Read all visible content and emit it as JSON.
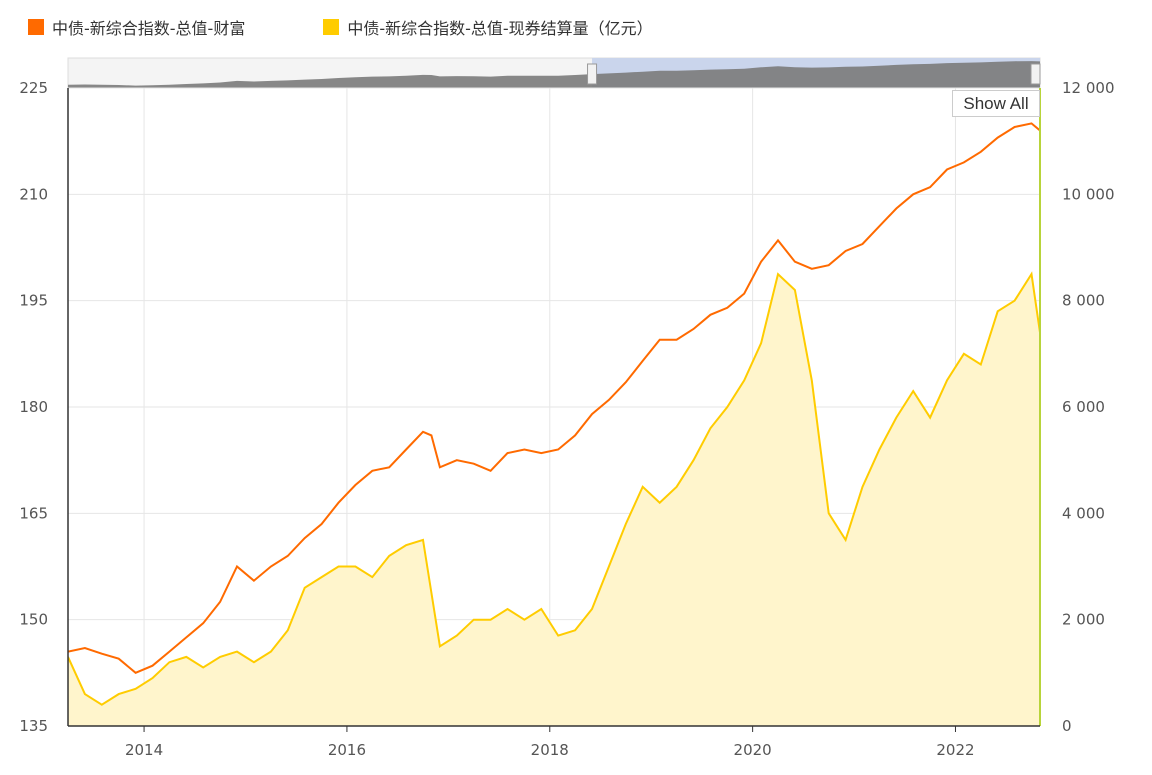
{
  "legend": {
    "items": [
      {
        "label": "中债-新综合指数-总值-财富",
        "color": "#ff6a00"
      },
      {
        "label": "中债-新综合指数-总值-现券结算量（亿元）",
        "color": "#ffcc00"
      }
    ]
  },
  "controls": {
    "show_all_label": "Show All"
  },
  "chart_data": {
    "type": "line",
    "x_range": [
      "2013-04",
      "2022-11"
    ],
    "x_ticks": [
      "2014",
      "2016",
      "2018",
      "2020",
      "2022"
    ],
    "y_left": {
      "range": [
        135,
        225
      ],
      "ticks": [
        "135",
        "150",
        "165",
        "180",
        "195",
        "210",
        "225"
      ]
    },
    "y_right": {
      "range": [
        0,
        12000
      ],
      "ticks": [
        "0",
        "2 000",
        "4 000",
        "6 000",
        "8 000",
        "10 000",
        "12 000"
      ]
    },
    "grid": true,
    "legend_position": "top-left",
    "navigator": {
      "selected_range": [
        "2018-06",
        "2022-11"
      ]
    },
    "series": [
      {
        "name": "中债-新综合指数-总值-财富",
        "axis": "left",
        "color": "#ff6a00",
        "kind": "line",
        "points": [
          [
            "2013-04",
            145.5
          ],
          [
            "2013-06",
            146.0
          ],
          [
            "2013-08",
            145.2
          ],
          [
            "2013-10",
            144.5
          ],
          [
            "2013-12",
            142.5
          ],
          [
            "2014-02",
            143.5
          ],
          [
            "2014-04",
            145.5
          ],
          [
            "2014-06",
            147.5
          ],
          [
            "2014-08",
            149.5
          ],
          [
            "2014-10",
            152.5
          ],
          [
            "2014-12",
            157.5
          ],
          [
            "2015-02",
            155.5
          ],
          [
            "2015-04",
            157.5
          ],
          [
            "2015-06",
            159.0
          ],
          [
            "2015-08",
            161.5
          ],
          [
            "2015-10",
            163.5
          ],
          [
            "2015-12",
            166.5
          ],
          [
            "2016-02",
            169.0
          ],
          [
            "2016-04",
            171.0
          ],
          [
            "2016-06",
            171.5
          ],
          [
            "2016-08",
            174.0
          ],
          [
            "2016-10",
            176.5
          ],
          [
            "2016-11",
            176.0
          ],
          [
            "2016-12",
            171.5
          ],
          [
            "2017-02",
            172.5
          ],
          [
            "2017-04",
            172.0
          ],
          [
            "2017-06",
            171.0
          ],
          [
            "2017-08",
            173.5
          ],
          [
            "2017-10",
            174.0
          ],
          [
            "2017-12",
            173.5
          ],
          [
            "2018-02",
            174.0
          ],
          [
            "2018-04",
            176.0
          ],
          [
            "2018-06",
            179.0
          ],
          [
            "2018-08",
            181.0
          ],
          [
            "2018-10",
            183.5
          ],
          [
            "2018-12",
            186.5
          ],
          [
            "2019-02",
            189.5
          ],
          [
            "2019-04",
            189.5
          ],
          [
            "2019-06",
            191.0
          ],
          [
            "2019-08",
            193.0
          ],
          [
            "2019-10",
            194.0
          ],
          [
            "2019-12",
            196.0
          ],
          [
            "2020-02",
            200.5
          ],
          [
            "2020-04",
            203.5
          ],
          [
            "2020-06",
            200.5
          ],
          [
            "2020-08",
            199.5
          ],
          [
            "2020-10",
            200.0
          ],
          [
            "2020-12",
            202.0
          ],
          [
            "2021-02",
            203.0
          ],
          [
            "2021-04",
            205.5
          ],
          [
            "2021-06",
            208.0
          ],
          [
            "2021-08",
            210.0
          ],
          [
            "2021-10",
            211.0
          ],
          [
            "2021-12",
            213.5
          ],
          [
            "2022-02",
            214.5
          ],
          [
            "2022-04",
            216.0
          ],
          [
            "2022-06",
            218.0
          ],
          [
            "2022-08",
            219.5
          ],
          [
            "2022-10",
            220.0
          ],
          [
            "2022-11",
            219.0
          ]
        ]
      },
      {
        "name": "中债-新综合指数-总值-现券结算量（亿元）",
        "axis": "right",
        "color": "#ffcc00",
        "kind": "area",
        "points": [
          [
            "2013-04",
            1300
          ],
          [
            "2013-06",
            600
          ],
          [
            "2013-08",
            400
          ],
          [
            "2013-10",
            600
          ],
          [
            "2013-12",
            700
          ],
          [
            "2014-02",
            900
          ],
          [
            "2014-04",
            1200
          ],
          [
            "2014-06",
            1300
          ],
          [
            "2014-08",
            1100
          ],
          [
            "2014-10",
            1300
          ],
          [
            "2014-12",
            1400
          ],
          [
            "2015-02",
            1200
          ],
          [
            "2015-04",
            1400
          ],
          [
            "2015-06",
            1800
          ],
          [
            "2015-08",
            2600
          ],
          [
            "2015-10",
            2800
          ],
          [
            "2015-12",
            3000
          ],
          [
            "2016-02",
            3000
          ],
          [
            "2016-04",
            2800
          ],
          [
            "2016-06",
            3200
          ],
          [
            "2016-08",
            3400
          ],
          [
            "2016-10",
            3500
          ],
          [
            "2016-12",
            1500
          ],
          [
            "2017-02",
            1700
          ],
          [
            "2017-04",
            2000
          ],
          [
            "2017-06",
            2000
          ],
          [
            "2017-08",
            2200
          ],
          [
            "2017-10",
            2000
          ],
          [
            "2017-12",
            2200
          ],
          [
            "2018-02",
            1700
          ],
          [
            "2018-04",
            1800
          ],
          [
            "2018-06",
            2200
          ],
          [
            "2018-08",
            3000
          ],
          [
            "2018-10",
            3800
          ],
          [
            "2018-12",
            4500
          ],
          [
            "2019-02",
            4200
          ],
          [
            "2019-04",
            4500
          ],
          [
            "2019-06",
            5000
          ],
          [
            "2019-08",
            5600
          ],
          [
            "2019-10",
            6000
          ],
          [
            "2019-12",
            6500
          ],
          [
            "2020-02",
            7200
          ],
          [
            "2020-04",
            8500
          ],
          [
            "2020-06",
            8200
          ],
          [
            "2020-08",
            6500
          ],
          [
            "2020-10",
            4000
          ],
          [
            "2020-12",
            3500
          ],
          [
            "2021-02",
            4500
          ],
          [
            "2021-04",
            5200
          ],
          [
            "2021-06",
            5800
          ],
          [
            "2021-08",
            6300
          ],
          [
            "2021-10",
            5800
          ],
          [
            "2021-12",
            6500
          ],
          [
            "2022-02",
            7000
          ],
          [
            "2022-04",
            6800
          ],
          [
            "2022-06",
            7800
          ],
          [
            "2022-08",
            8000
          ],
          [
            "2022-10",
            8500
          ],
          [
            "2022-11",
            7400
          ]
        ]
      }
    ]
  }
}
